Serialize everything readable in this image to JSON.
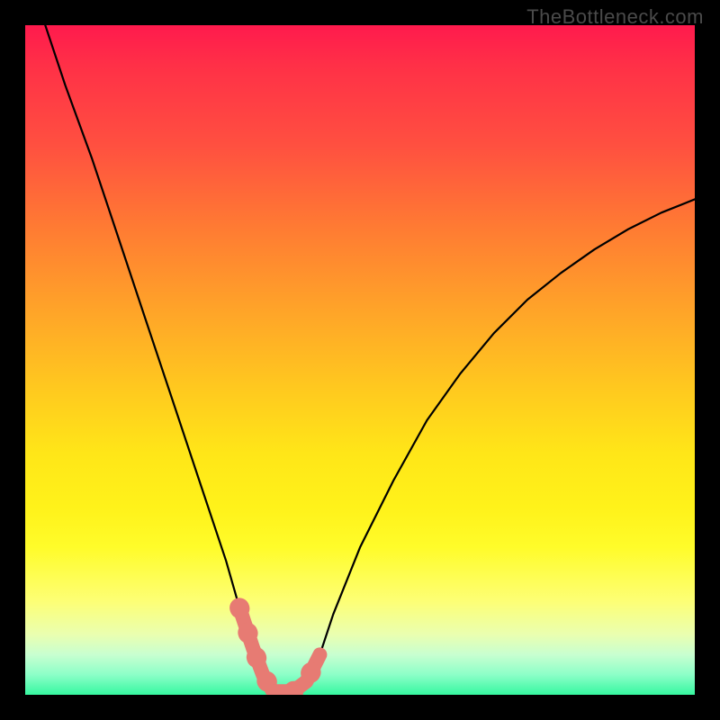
{
  "watermark": {
    "text": "TheBottleneck.com"
  },
  "chart_data": {
    "type": "line",
    "title": "",
    "xlabel": "",
    "ylabel": "",
    "xlim": [
      0,
      100
    ],
    "ylim": [
      0,
      100
    ],
    "legend": false,
    "grid": false,
    "series": [
      {
        "name": "bottleneck-curve",
        "x": [
          3,
          6,
          10,
          14,
          18,
          22,
          26,
          30,
          32,
          34,
          35.5,
          37,
          38.5,
          40,
          42,
          44,
          46,
          50,
          55,
          60,
          65,
          70,
          75,
          80,
          85,
          90,
          95,
          100
        ],
        "y": [
          100,
          91,
          80,
          68,
          56,
          44,
          32,
          20,
          13,
          7,
          3,
          0.5,
          0.5,
          0.5,
          2,
          6,
          12,
          22,
          32,
          41,
          48,
          54,
          59,
          63,
          66.5,
          69.5,
          72,
          74
        ]
      }
    ],
    "highlight_segments": [
      {
        "start_index": 8,
        "end_index": 11
      },
      {
        "start_index": 13,
        "end_index": 15
      }
    ]
  }
}
